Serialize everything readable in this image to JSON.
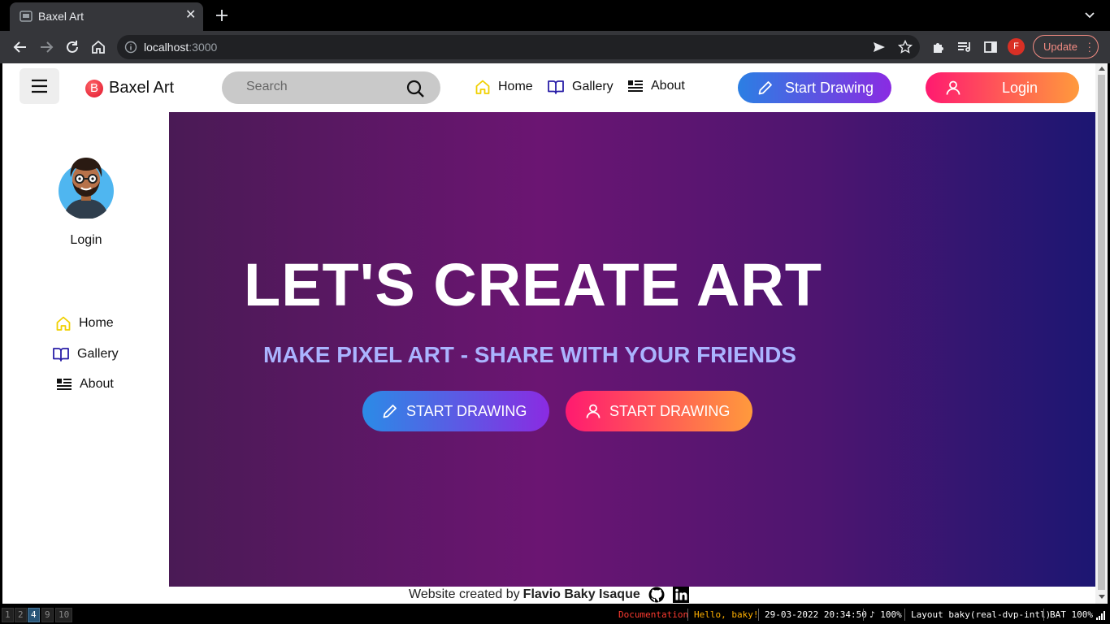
{
  "browser": {
    "tab_title": "Baxel Art",
    "tab_close": "✕",
    "url_host": "localhost",
    "url_port": ":3000",
    "update_label": "Update",
    "profile_initial": "F"
  },
  "navbar": {
    "brand_logo": "B",
    "brand_name": "Baxel Art",
    "search_placeholder": "Search",
    "links": [
      {
        "label": "Home",
        "icon": "home-icon"
      },
      {
        "label": "Gallery",
        "icon": "book-icon"
      },
      {
        "label": "About",
        "icon": "about-icon"
      }
    ],
    "start_drawing_label": "Start Drawing",
    "login_label": "Login"
  },
  "sidebar": {
    "login_label": "Login",
    "links": [
      {
        "label": "Home",
        "icon": "home-icon"
      },
      {
        "label": "Gallery",
        "icon": "book-icon"
      },
      {
        "label": "About",
        "icon": "about-icon"
      }
    ]
  },
  "hero": {
    "title": "LET'S CREATE ART",
    "subtitle": "MAKE PIXEL ART - SHARE WITH YOUR FRIENDS",
    "button_draw": "START DRAWING",
    "button_login": "START DRAWING"
  },
  "footer": {
    "prefix": "Website created by",
    "author": "Flavio Baky Isaque"
  },
  "statusbar": {
    "workspaces": [
      "1",
      "2",
      "4",
      "9",
      "10"
    ],
    "active_workspace": "4",
    "items": [
      {
        "text": "Documentation",
        "color": "#ff3b30"
      },
      {
        "text": "Hello, baky!",
        "color": "#ffb000"
      },
      {
        "text": "29-03-2022 20:34:50",
        "color": "#ffffff"
      },
      {
        "text": "♪ 100%",
        "color": "#ffffff"
      },
      {
        "text": "Layout baky(real-dvp-intl)",
        "color": "#ffffff"
      },
      {
        "text": "BAT 100%",
        "color": "#ffffff"
      }
    ]
  },
  "colors": {
    "home_icon": "#f0d000",
    "book_icon": "#2a1fa8",
    "hero_subtitle": "#aab4ff"
  }
}
